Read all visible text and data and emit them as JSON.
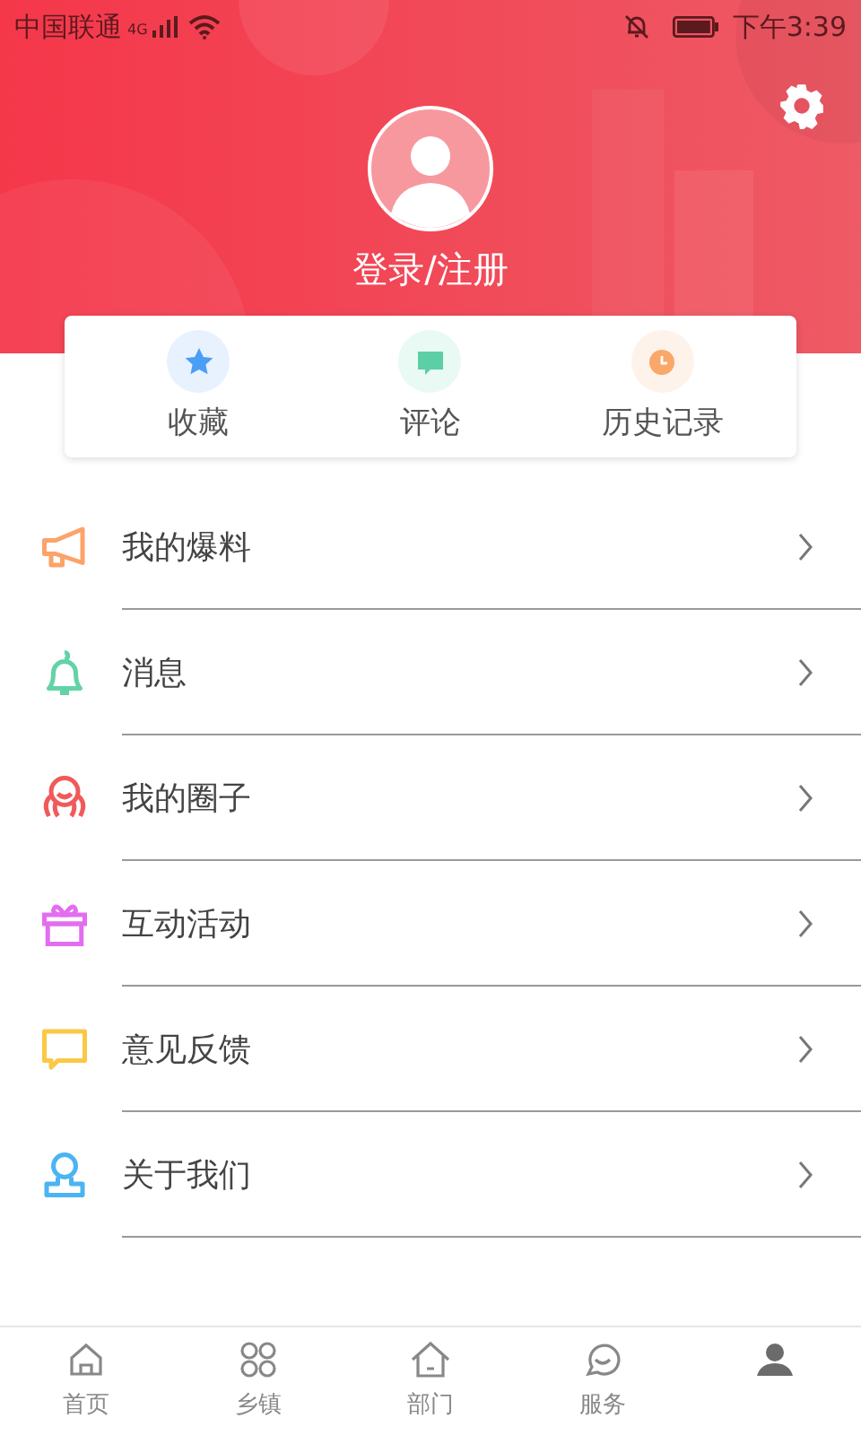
{
  "status_bar": {
    "carrier": "中国联通",
    "network": "4G",
    "time": "下午3:39"
  },
  "header": {
    "login_label": "登录/注册"
  },
  "quick_actions": [
    {
      "kind": "star",
      "label": "收藏",
      "color": "#4a9ff5"
    },
    {
      "kind": "comment",
      "label": "评论",
      "color": "#5ccfa6"
    },
    {
      "kind": "clock",
      "label": "历史记录",
      "color": "#f9a869"
    }
  ],
  "menu": [
    {
      "kind": "megaphone",
      "label": "我的爆料",
      "color": "#fca36a"
    },
    {
      "kind": "bell",
      "label": "消息",
      "color": "#62d3a6"
    },
    {
      "kind": "circle",
      "label": "我的圈子",
      "color": "#f05a5a"
    },
    {
      "kind": "gift",
      "label": "互动活动",
      "color": "#e36df0"
    },
    {
      "kind": "feedback",
      "label": "意见反馈",
      "color": "#fbc845"
    },
    {
      "kind": "about",
      "label": "关于我们",
      "color": "#4bb4f2"
    }
  ],
  "tabs": [
    {
      "kind": "home",
      "label": "首页",
      "selected": false
    },
    {
      "kind": "grid",
      "label": "乡镇",
      "selected": false
    },
    {
      "kind": "house",
      "label": "部门",
      "selected": false
    },
    {
      "kind": "chat",
      "label": "服务",
      "selected": false
    },
    {
      "kind": "person",
      "selected": true
    }
  ]
}
